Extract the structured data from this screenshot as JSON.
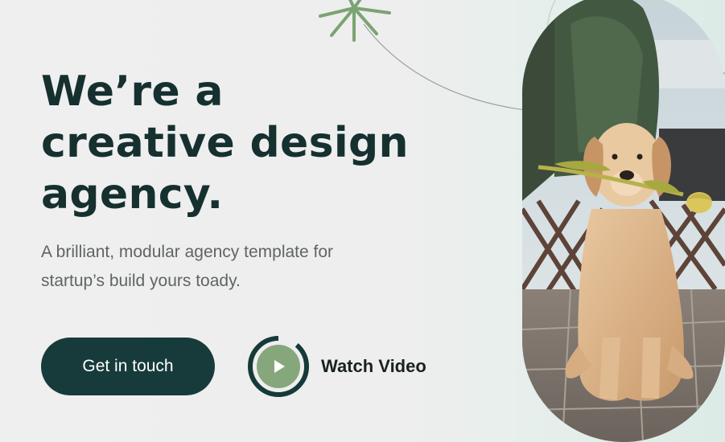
{
  "hero": {
    "title_lines": [
      "We’re a",
      "creative design",
      "agency."
    ],
    "subtitle_lines": [
      "A brilliant, modular agency template for",
      "startup’s build yours toady."
    ],
    "cta_label": "Get in touch",
    "watch_label": "Watch Video"
  },
  "colors": {
    "heading": "#163030",
    "cta_background": "#173b3a",
    "play_accent": "#86a77c",
    "starburst": "#7aa472"
  },
  "icons": {
    "play": "play-icon",
    "decoration": "starburst-icon"
  },
  "image": {
    "subject": "golden retriever puppy holding a yellow tulip",
    "shape": "pill"
  }
}
